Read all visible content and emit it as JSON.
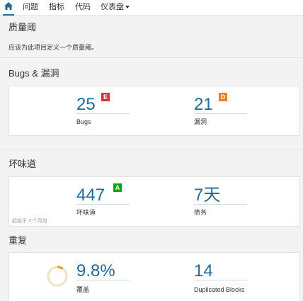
{
  "nav": {
    "items": [
      "问题",
      "指标",
      "代码",
      "仪表盘"
    ]
  },
  "quality_gate": {
    "title": "质量阈",
    "message": "应该为此项目定义一个质量阈。"
  },
  "bugs_vuln": {
    "title": "Bugs & 漏洞",
    "bugs": {
      "value": "25",
      "label": "Bugs",
      "rating": "E",
      "rating_color": "#d4333f"
    },
    "vulnerabilities": {
      "value": "21",
      "label": "漏洞",
      "rating": "D",
      "rating_color": "#ed7d20"
    }
  },
  "code_smells": {
    "title": "坏味道",
    "since": "起始于 3 个月前",
    "smells": {
      "value": "447",
      "label": "坏味道",
      "rating": "A",
      "rating_color": "#00aa00"
    },
    "debt": {
      "value": "7天",
      "label": "债务"
    }
  },
  "duplications": {
    "title": "重复",
    "coverage": {
      "value": "9.8%",
      "label": "覆盖",
      "fraction": 0.098
    },
    "blocks": {
      "value": "14",
      "label": "Duplicated Blocks"
    }
  },
  "colors": {
    "accent": "#236a97"
  }
}
